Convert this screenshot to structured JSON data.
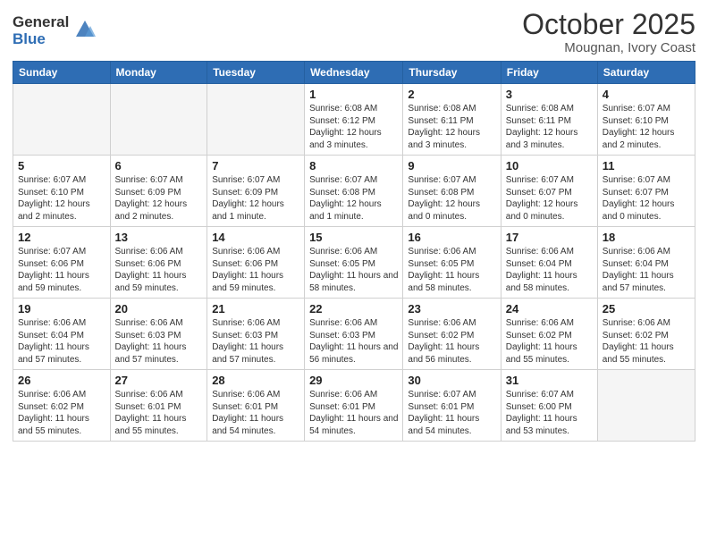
{
  "header": {
    "logo_general": "General",
    "logo_blue": "Blue",
    "month": "October 2025",
    "location": "Mougnan, Ivory Coast"
  },
  "weekdays": [
    "Sunday",
    "Monday",
    "Tuesday",
    "Wednesday",
    "Thursday",
    "Friday",
    "Saturday"
  ],
  "weeks": [
    [
      {
        "day": "",
        "info": ""
      },
      {
        "day": "",
        "info": ""
      },
      {
        "day": "",
        "info": ""
      },
      {
        "day": "1",
        "info": "Sunrise: 6:08 AM\nSunset: 6:12 PM\nDaylight: 12 hours and 3 minutes."
      },
      {
        "day": "2",
        "info": "Sunrise: 6:08 AM\nSunset: 6:11 PM\nDaylight: 12 hours and 3 minutes."
      },
      {
        "day": "3",
        "info": "Sunrise: 6:08 AM\nSunset: 6:11 PM\nDaylight: 12 hours and 3 minutes."
      },
      {
        "day": "4",
        "info": "Sunrise: 6:07 AM\nSunset: 6:10 PM\nDaylight: 12 hours and 2 minutes."
      }
    ],
    [
      {
        "day": "5",
        "info": "Sunrise: 6:07 AM\nSunset: 6:10 PM\nDaylight: 12 hours and 2 minutes."
      },
      {
        "day": "6",
        "info": "Sunrise: 6:07 AM\nSunset: 6:09 PM\nDaylight: 12 hours and 2 minutes."
      },
      {
        "day": "7",
        "info": "Sunrise: 6:07 AM\nSunset: 6:09 PM\nDaylight: 12 hours and 1 minute."
      },
      {
        "day": "8",
        "info": "Sunrise: 6:07 AM\nSunset: 6:08 PM\nDaylight: 12 hours and 1 minute."
      },
      {
        "day": "9",
        "info": "Sunrise: 6:07 AM\nSunset: 6:08 PM\nDaylight: 12 hours and 0 minutes."
      },
      {
        "day": "10",
        "info": "Sunrise: 6:07 AM\nSunset: 6:07 PM\nDaylight: 12 hours and 0 minutes."
      },
      {
        "day": "11",
        "info": "Sunrise: 6:07 AM\nSunset: 6:07 PM\nDaylight: 12 hours and 0 minutes."
      }
    ],
    [
      {
        "day": "12",
        "info": "Sunrise: 6:07 AM\nSunset: 6:06 PM\nDaylight: 11 hours and 59 minutes."
      },
      {
        "day": "13",
        "info": "Sunrise: 6:06 AM\nSunset: 6:06 PM\nDaylight: 11 hours and 59 minutes."
      },
      {
        "day": "14",
        "info": "Sunrise: 6:06 AM\nSunset: 6:06 PM\nDaylight: 11 hours and 59 minutes."
      },
      {
        "day": "15",
        "info": "Sunrise: 6:06 AM\nSunset: 6:05 PM\nDaylight: 11 hours and 58 minutes."
      },
      {
        "day": "16",
        "info": "Sunrise: 6:06 AM\nSunset: 6:05 PM\nDaylight: 11 hours and 58 minutes."
      },
      {
        "day": "17",
        "info": "Sunrise: 6:06 AM\nSunset: 6:04 PM\nDaylight: 11 hours and 58 minutes."
      },
      {
        "day": "18",
        "info": "Sunrise: 6:06 AM\nSunset: 6:04 PM\nDaylight: 11 hours and 57 minutes."
      }
    ],
    [
      {
        "day": "19",
        "info": "Sunrise: 6:06 AM\nSunset: 6:04 PM\nDaylight: 11 hours and 57 minutes."
      },
      {
        "day": "20",
        "info": "Sunrise: 6:06 AM\nSunset: 6:03 PM\nDaylight: 11 hours and 57 minutes."
      },
      {
        "day": "21",
        "info": "Sunrise: 6:06 AM\nSunset: 6:03 PM\nDaylight: 11 hours and 57 minutes."
      },
      {
        "day": "22",
        "info": "Sunrise: 6:06 AM\nSunset: 6:03 PM\nDaylight: 11 hours and 56 minutes."
      },
      {
        "day": "23",
        "info": "Sunrise: 6:06 AM\nSunset: 6:02 PM\nDaylight: 11 hours and 56 minutes."
      },
      {
        "day": "24",
        "info": "Sunrise: 6:06 AM\nSunset: 6:02 PM\nDaylight: 11 hours and 55 minutes."
      },
      {
        "day": "25",
        "info": "Sunrise: 6:06 AM\nSunset: 6:02 PM\nDaylight: 11 hours and 55 minutes."
      }
    ],
    [
      {
        "day": "26",
        "info": "Sunrise: 6:06 AM\nSunset: 6:02 PM\nDaylight: 11 hours and 55 minutes."
      },
      {
        "day": "27",
        "info": "Sunrise: 6:06 AM\nSunset: 6:01 PM\nDaylight: 11 hours and 55 minutes."
      },
      {
        "day": "28",
        "info": "Sunrise: 6:06 AM\nSunset: 6:01 PM\nDaylight: 11 hours and 54 minutes."
      },
      {
        "day": "29",
        "info": "Sunrise: 6:06 AM\nSunset: 6:01 PM\nDaylight: 11 hours and 54 minutes."
      },
      {
        "day": "30",
        "info": "Sunrise: 6:07 AM\nSunset: 6:01 PM\nDaylight: 11 hours and 54 minutes."
      },
      {
        "day": "31",
        "info": "Sunrise: 6:07 AM\nSunset: 6:00 PM\nDaylight: 11 hours and 53 minutes."
      },
      {
        "day": "",
        "info": ""
      }
    ]
  ]
}
